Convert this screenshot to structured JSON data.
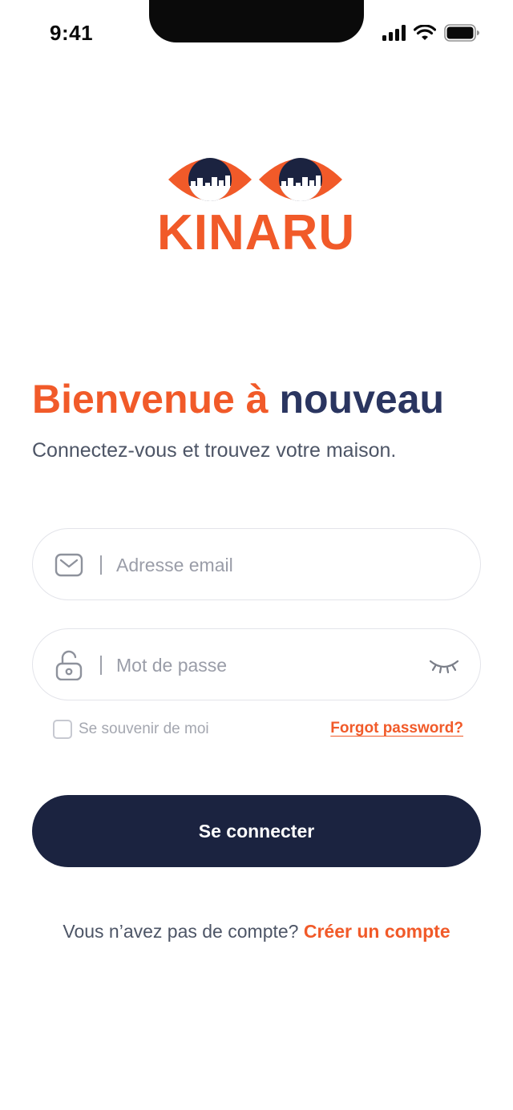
{
  "status_bar": {
    "time": "9:41"
  },
  "logo": {
    "brand": "KINARU",
    "brand_color": "#f15a29"
  },
  "header": {
    "title_part1": "Bienvenue à",
    "title_part2": "nouveau",
    "subtitle": "Connectez-vous et trouvez votre maison."
  },
  "form": {
    "email": {
      "placeholder": "Adresse email",
      "value": "",
      "icon": "mail-icon"
    },
    "password": {
      "placeholder": "Mot de passe",
      "value": "",
      "icon": "lock-icon",
      "toggle_icon": "eye-closed-icon"
    },
    "remember_label": "Se souvenir de moi",
    "remember_checked": false,
    "forgot_label": "Forgot password?",
    "submit_label": "Se connecter"
  },
  "footer": {
    "prompt": "Vous n’avez pas de compte?",
    "signup_link": "Créer un compte"
  },
  "colors": {
    "accent": "#f15a29",
    "primary_dark": "#1b2340",
    "title_dark": "#2a3560"
  }
}
